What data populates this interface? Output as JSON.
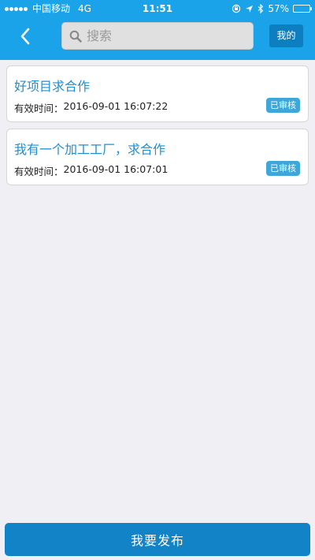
{
  "status_bar": {
    "carrier": "中国移动",
    "network": "4G",
    "time": "11:51",
    "battery_percent": "57%",
    "battery_level": 0.57
  },
  "header": {
    "search_placeholder": "搜索",
    "mine_label": "我的"
  },
  "items": [
    {
      "title": "好项目求合作",
      "meta_label": "有效时间：",
      "meta_value": "2016-09-01 16:07:22",
      "status": "已审核"
    },
    {
      "title": "我有一个加工工厂，求合作",
      "meta_label": "有效时间：",
      "meta_value": "2016-09-01 16:07:01",
      "status": "已审核"
    }
  ],
  "footer": {
    "publish_label": "我要发布"
  },
  "colors": {
    "header_bg": "#1aa3e8",
    "accent": "#1183c6",
    "badge": "#3fa7d8",
    "title_text": "#1e8fd0"
  }
}
